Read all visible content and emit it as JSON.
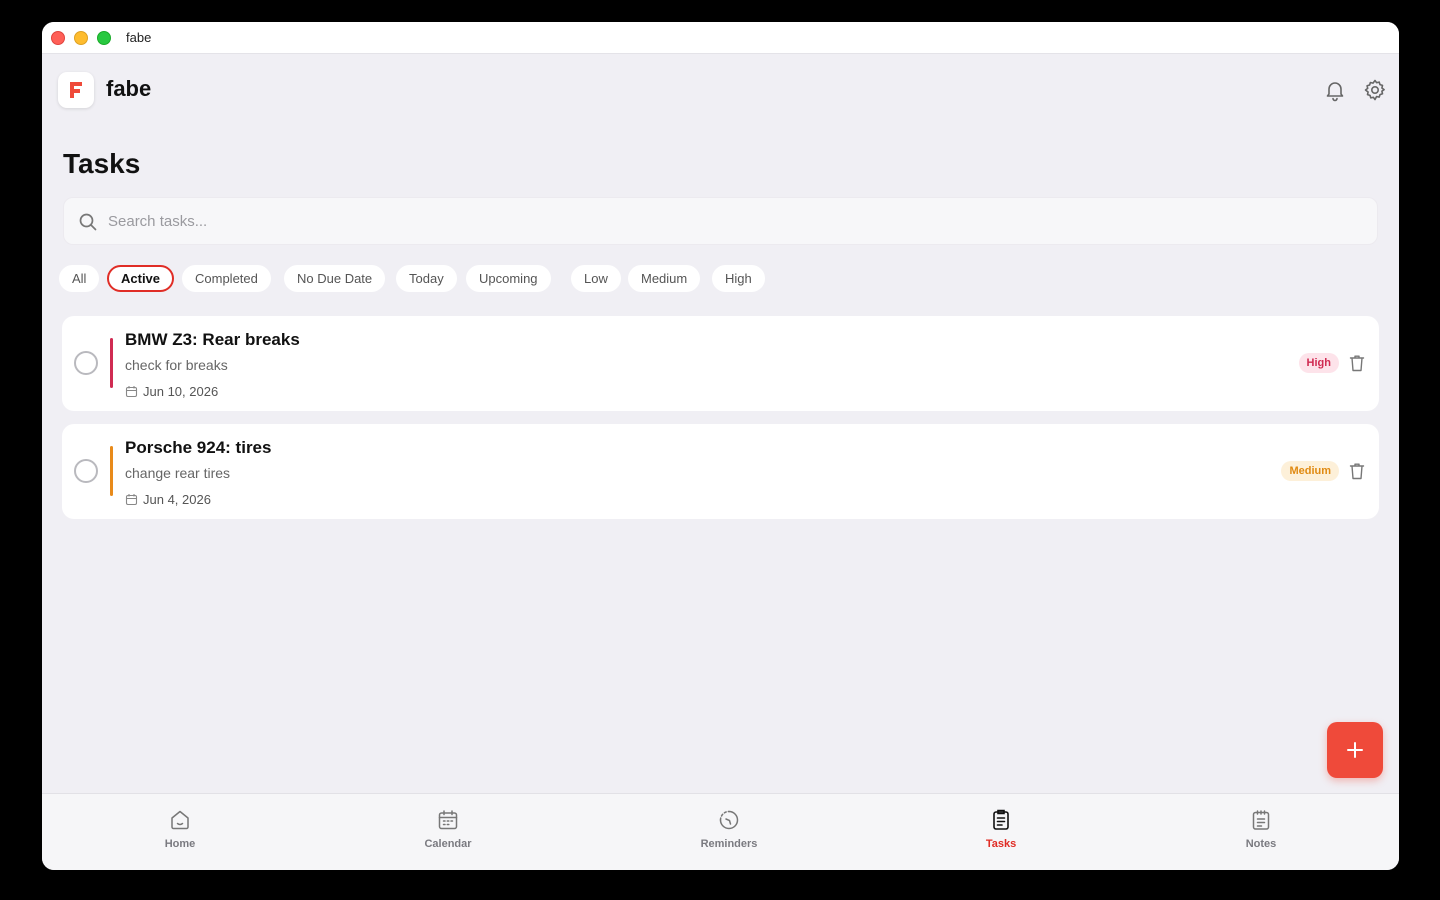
{
  "window": {
    "title": "fabe"
  },
  "header": {
    "app_name": "fabe",
    "logo_letter": "F"
  },
  "page": {
    "title": "Tasks"
  },
  "search": {
    "placeholder": "Search tasks..."
  },
  "filters": [
    {
      "label": "All",
      "active": false
    },
    {
      "label": "Active",
      "active": true
    },
    {
      "label": "Completed",
      "active": false
    },
    {
      "label": "No Due Date",
      "active": false
    },
    {
      "label": "Today",
      "active": false
    },
    {
      "label": "Upcoming",
      "active": false
    },
    {
      "label": "Low",
      "active": false
    },
    {
      "label": "Medium",
      "active": false
    },
    {
      "label": "High",
      "active": false
    }
  ],
  "tasks": [
    {
      "title": "BMW Z3: Rear breaks",
      "description": "check for breaks",
      "due": "Jun 10, 2026",
      "priority": "High",
      "color": "#d02b52"
    },
    {
      "title": "Porsche 924: tires",
      "description": "change rear tires",
      "due": "Jun 4, 2026",
      "priority": "Medium",
      "color": "#e88a1a"
    }
  ],
  "tabs": [
    {
      "label": "Home",
      "icon": "home-icon",
      "active": false
    },
    {
      "label": "Calendar",
      "icon": "calendar-icon",
      "active": false
    },
    {
      "label": "Reminders",
      "icon": "reminder-icon",
      "active": false
    },
    {
      "label": "Tasks",
      "icon": "tasks-icon",
      "active": true
    },
    {
      "label": "Notes",
      "icon": "notes-icon",
      "active": false
    }
  ],
  "colors": {
    "accent": "#e02d26",
    "fab": "#ef4a3a",
    "background": "#f0eff4"
  }
}
